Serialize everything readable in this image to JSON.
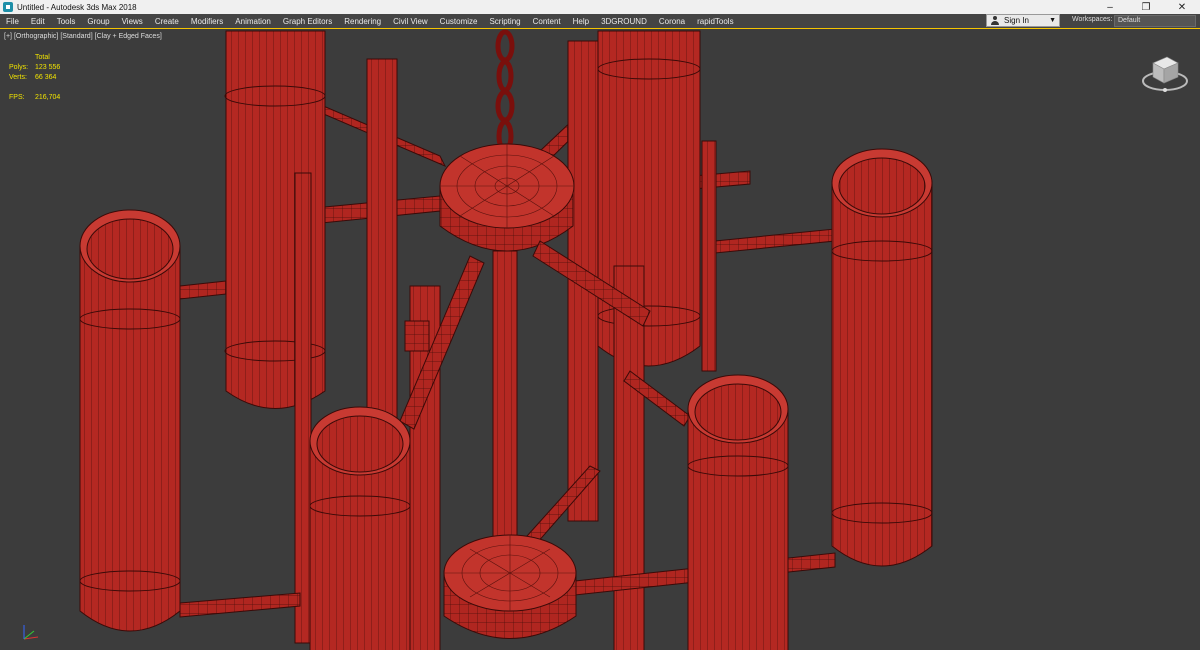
{
  "window": {
    "title": "Untitled - Autodesk 3ds Max 2018",
    "controls": [
      "–",
      "❐",
      "✕"
    ]
  },
  "menu": {
    "items": [
      "File",
      "Edit",
      "Tools",
      "Group",
      "Views",
      "Create",
      "Modifiers",
      "Animation",
      "Graph Editors",
      "Rendering",
      "Civil View",
      "Customize",
      "Scripting",
      "Content",
      "Help",
      "3DGROUND",
      "Corona",
      "rapidTools"
    ]
  },
  "account": {
    "signin_label": "Sign In",
    "workspaces_label": "Workspaces:",
    "workspace_value": "Default"
  },
  "viewport": {
    "labels": [
      "[+]",
      "[Orthographic]",
      "[Standard]",
      "[Clay + Edged Faces]"
    ],
    "stats": {
      "total_label": "Total",
      "polys_label": "Polys:",
      "polys_value": "123 556",
      "verts_label": "Verts:",
      "verts_value": "66 364",
      "fps_label": "FPS:",
      "fps_value": "216,704"
    }
  },
  "colors": {
    "accent_border": "#f4c400",
    "model": "#b02620",
    "stats_text": "#f2e400"
  },
  "icons": [
    "app-icon",
    "user-icon",
    "viewcube-icon",
    "axis-tripod-icon"
  ]
}
